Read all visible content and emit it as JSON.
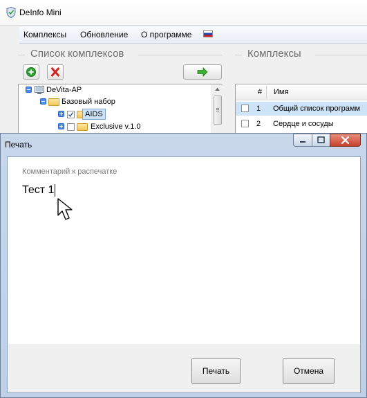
{
  "main_window": {
    "title": "DeInfo Mini",
    "menu": [
      "Комплексы",
      "Обновление",
      "О программе"
    ]
  },
  "left_panel": {
    "title": "Список комплексов",
    "tree": [
      {
        "label": "DeVita-AP",
        "expanded": true
      },
      {
        "label": "Базовый набор",
        "expanded": true
      },
      {
        "label": "AIDS",
        "checked": true,
        "selected": true
      },
      {
        "label": "Exclusive v.1.0",
        "checked": false
      }
    ]
  },
  "right_panel": {
    "title": "Комплексы",
    "columns": [
      "#",
      "Имя"
    ],
    "rows": [
      {
        "num": "1",
        "name": "Общий список программ",
        "selected": true
      },
      {
        "num": "2",
        "name": "Сердце и сосуды",
        "selected": false
      }
    ]
  },
  "print_dialog": {
    "title": "Печать",
    "comment_label": "Комментарий к распечатке",
    "comment_value": "Тест 1",
    "print_button": "Печать",
    "cancel_button": "Отмена"
  },
  "colors": {
    "accent_green": "#2f9e2f",
    "delete_red": "#d42020",
    "selection": "#cde3f7",
    "dialog_frame": "#bcd0e8"
  }
}
